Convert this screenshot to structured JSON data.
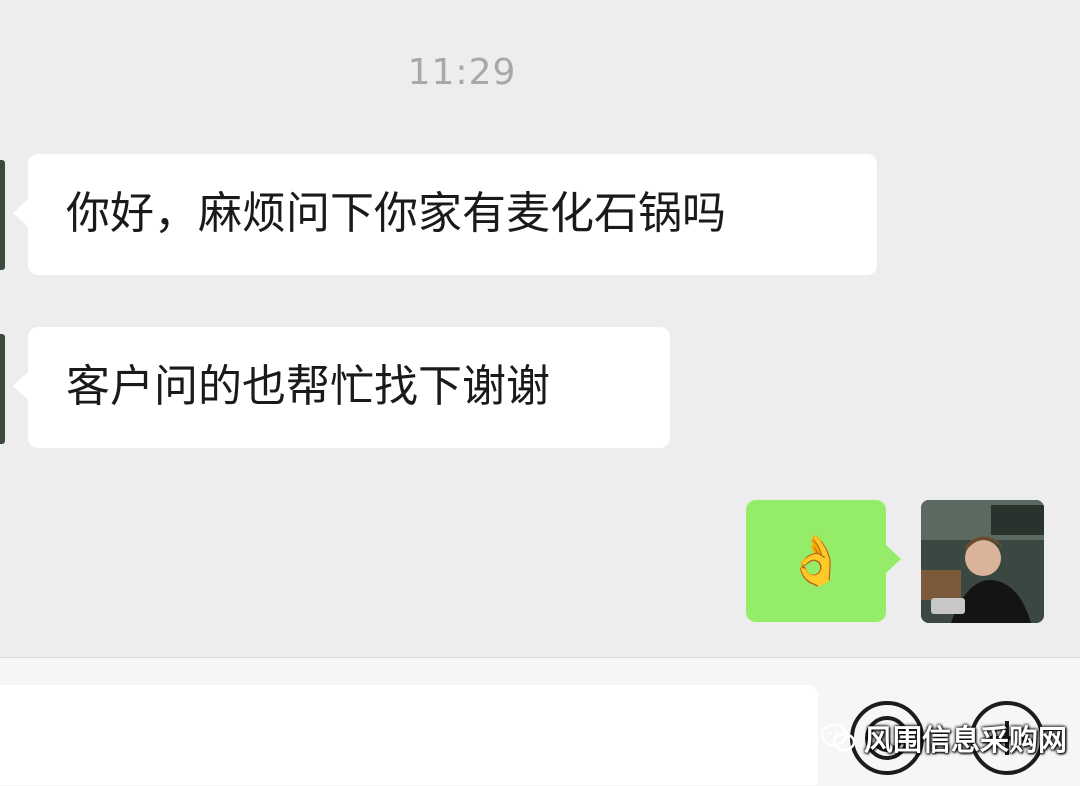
{
  "chat": {
    "timestamp": "11:29",
    "messages": [
      {
        "sender": "other",
        "text": "你好，麻烦问下你家有麦化石锅吗"
      },
      {
        "sender": "other",
        "text": "客户问的也帮忙找下谢谢"
      },
      {
        "sender": "self",
        "emoji": "👌"
      }
    ]
  },
  "icons": {
    "emoji_button": "smiley-icon",
    "more_button": "plus-icon",
    "watermark_logo": "wechat-logo-icon"
  },
  "colors": {
    "background": "#ededed",
    "incoming_bubble": "#ffffff",
    "outgoing_bubble": "#95ec69",
    "timestamp_text": "#a8a8a8"
  },
  "watermark": {
    "text": "风围信息采购网"
  }
}
